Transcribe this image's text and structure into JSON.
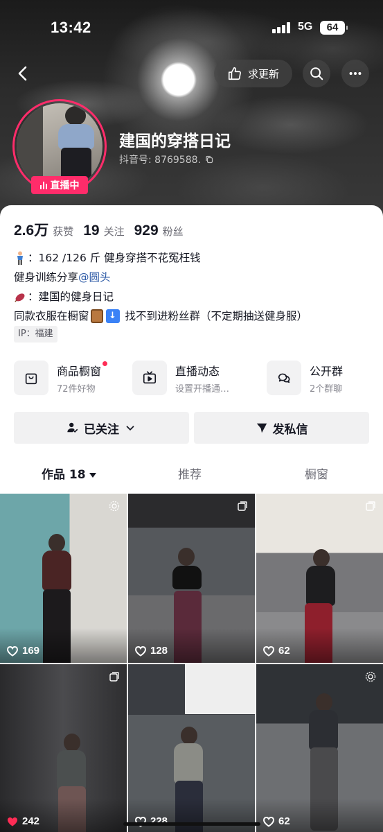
{
  "status_bar": {
    "time": "13:42",
    "network": "5G",
    "battery": "64"
  },
  "header": {
    "update_label": "求更新",
    "icons": [
      "back-icon",
      "thumbs-up-icon",
      "search-icon",
      "more-icon"
    ]
  },
  "profile": {
    "nickname": "建国的穿搭日记",
    "douyin_id": "抖音号: 8769588.",
    "live_badge": "直播中",
    "stats": [
      {
        "value": "2.6万",
        "label": "获赞"
      },
      {
        "value": "19",
        "label": "关注"
      },
      {
        "value": "929",
        "label": "粉丝"
      }
    ],
    "bio": {
      "line1": "：162 /126 斤  健身穿搭不花冤枉钱",
      "line2_text": "健身训练分享",
      "line2_mention": "@圆头",
      "line3": "：建国的健身日记",
      "line4_a": "同款衣服在橱窗",
      "line4_b": "找不到进粉丝群（不定期抽送健身服）"
    },
    "ip": "IP：福建"
  },
  "features": [
    {
      "title": "商品橱窗",
      "sub": "72件好物",
      "icon": "shopping-bag-icon",
      "has_dot": true
    },
    {
      "title": "直播动态",
      "sub": "设置开播通…",
      "icon": "tv-icon",
      "has_dot": false
    },
    {
      "title": "公开群",
      "sub": "2个群聊",
      "icon": "chat-bubbles-icon",
      "has_dot": false
    }
  ],
  "actions": {
    "follow": "已关注",
    "message": "发私信"
  },
  "tabs": [
    {
      "label": "作品 18",
      "active": true
    },
    {
      "label": "推荐",
      "active": false
    },
    {
      "label": "橱窗",
      "active": false
    }
  ],
  "videos": [
    {
      "likes": "169",
      "corner": "live-photo-icon"
    },
    {
      "likes": "128",
      "corner": "image-icon"
    },
    {
      "likes": "62",
      "corner": "image-icon"
    },
    {
      "likes": "242",
      "corner": "image-icon",
      "liked": true
    },
    {
      "likes": "228",
      "corner": ""
    },
    {
      "likes": "62",
      "corner": "live-photo-icon"
    }
  ],
  "colors": {
    "accent": "#fe2c55",
    "live": "#ff2c6a",
    "mention": "#2d5aa6"
  }
}
